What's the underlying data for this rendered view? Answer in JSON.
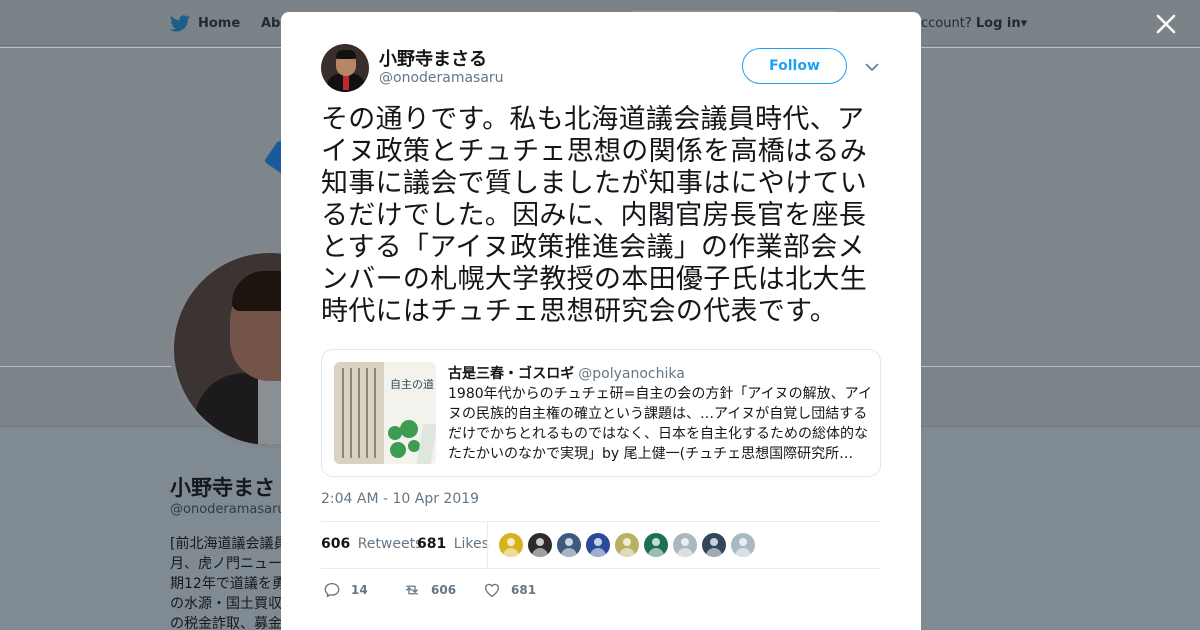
{
  "background_page": {
    "nav": {
      "home_label": "Home",
      "about_label": "Abo",
      "account_text": "ccount?",
      "login_label": "Log in"
    },
    "profile": {
      "name": "小野寺まさ",
      "handle": "@onoderamasaru",
      "bio_lines": [
        "[前北海道議会議員",
        "月、虎ノ門ニュー",
        "期12年で道議を勇",
        "の水源・国土買収",
        "の税金詐取、募金"
      ]
    }
  },
  "close_button": {
    "icon": "close-icon"
  },
  "tweet": {
    "author": {
      "name": "小野寺まさる",
      "handle": "@onoderamasaru"
    },
    "follow_label": "Follow",
    "text": "その通りです。私も北海道議会議員時代、アイヌ政策とチュチェ思想の関係を高橋はるみ知事に議会で質しましたが知事はにやけているだけでした。因みに、内閣官房長官を座長とする「アイヌ政策推進会議」の作業部会メンバーの札幌大学教授の本田優子氏は北大生時代にはチュチェ思想研究会の代表です。",
    "quoted": {
      "author_name": "古是三春・ゴスロギ",
      "author_handle": "@polyanochika",
      "thumbnail_title": "自主の道",
      "text": "1980年代からのチュチェ研=自主の会の方針「アイヌの解放、アイヌの民族的自主権の確立という課題は、…アイヌが自覚し団結するだけでかちとれるものではなく、日本を自主化するための総体的なたたかいのなかで実現」by 尾上健一(チュチェ思想国際研究所…"
    },
    "timestamp": "2:04 AM - 10 Apr 2019",
    "stats": {
      "retweets_count": "606",
      "retweets_label": "Retweets",
      "likes_count": "681",
      "likes_label": "Likes"
    },
    "liker_avatars": [
      {
        "name": "liker-avatar-1",
        "color": "#d8b21a"
      },
      {
        "name": "liker-avatar-2",
        "color": "#2b2b2b"
      },
      {
        "name": "liker-avatar-3",
        "color": "#3c5a7e"
      },
      {
        "name": "liker-avatar-4",
        "color": "#2a4a9a"
      },
      {
        "name": "liker-avatar-5",
        "color": "#b9b060"
      },
      {
        "name": "liker-avatar-6",
        "color": "#1f6f55"
      },
      {
        "name": "liker-avatar-7",
        "color": "#aab8c2"
      },
      {
        "name": "liker-avatar-8",
        "color": "#32465c"
      },
      {
        "name": "liker-avatar-9",
        "color": "#aab8c2"
      }
    ],
    "actions": {
      "reply_count": "14",
      "retweet_count": "606",
      "like_count": "681"
    }
  },
  "colors": {
    "accent": "#1da1f2",
    "text": "#14171a",
    "secondary": "#657786",
    "overlay": "#7f8a92"
  }
}
